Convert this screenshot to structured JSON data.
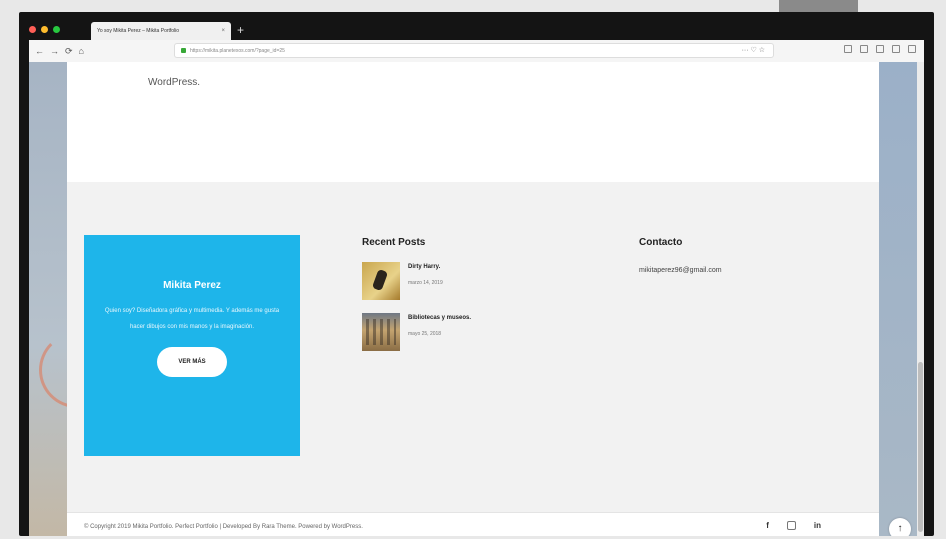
{
  "browser": {
    "dot_colors": [
      "#ff5f57",
      "#febc2e",
      "#28c840"
    ],
    "tab_title": "Yo soy Mikita Perez – Mikita Portfolio",
    "tab_close": "×",
    "new_tab": "+",
    "nav": {
      "back": "←",
      "forward": "→",
      "reload": "⟳",
      "home": "⌂"
    },
    "url": "https://mikita.planetexos.com/?page_id=25",
    "url_actions": "··· ♡ ☆"
  },
  "page": {
    "wordpress_text": "WordPress.",
    "cta": {
      "title": "Mikita Perez",
      "text": "Quien soy? Diseñadora gráfica y multimedia. Y además me gusta hacer dibujos con mis manos y la imaginación.",
      "button": "VER MÁS"
    },
    "recent_posts": {
      "title": "Recent Posts",
      "items": [
        {
          "title": "Dirty Harry.",
          "date": "marzo 14, 2019"
        },
        {
          "title": "Bibliotecas y museos.",
          "date": "mayo 25, 2018"
        }
      ]
    },
    "contact": {
      "title": "Contacto",
      "email": "mikitaperez96@gmail.com"
    },
    "footer": {
      "copyright": "© Copyright 2019 Mikita Portfolio. Perfect Portfolio | Developed By Rara Theme. Powered by WordPress.",
      "social": {
        "facebook": "f",
        "linkedin": "in"
      },
      "scroll_top": "↑"
    }
  },
  "colors": {
    "accent": "#1eb5ea",
    "footer_bg": "#f2f2f2"
  }
}
